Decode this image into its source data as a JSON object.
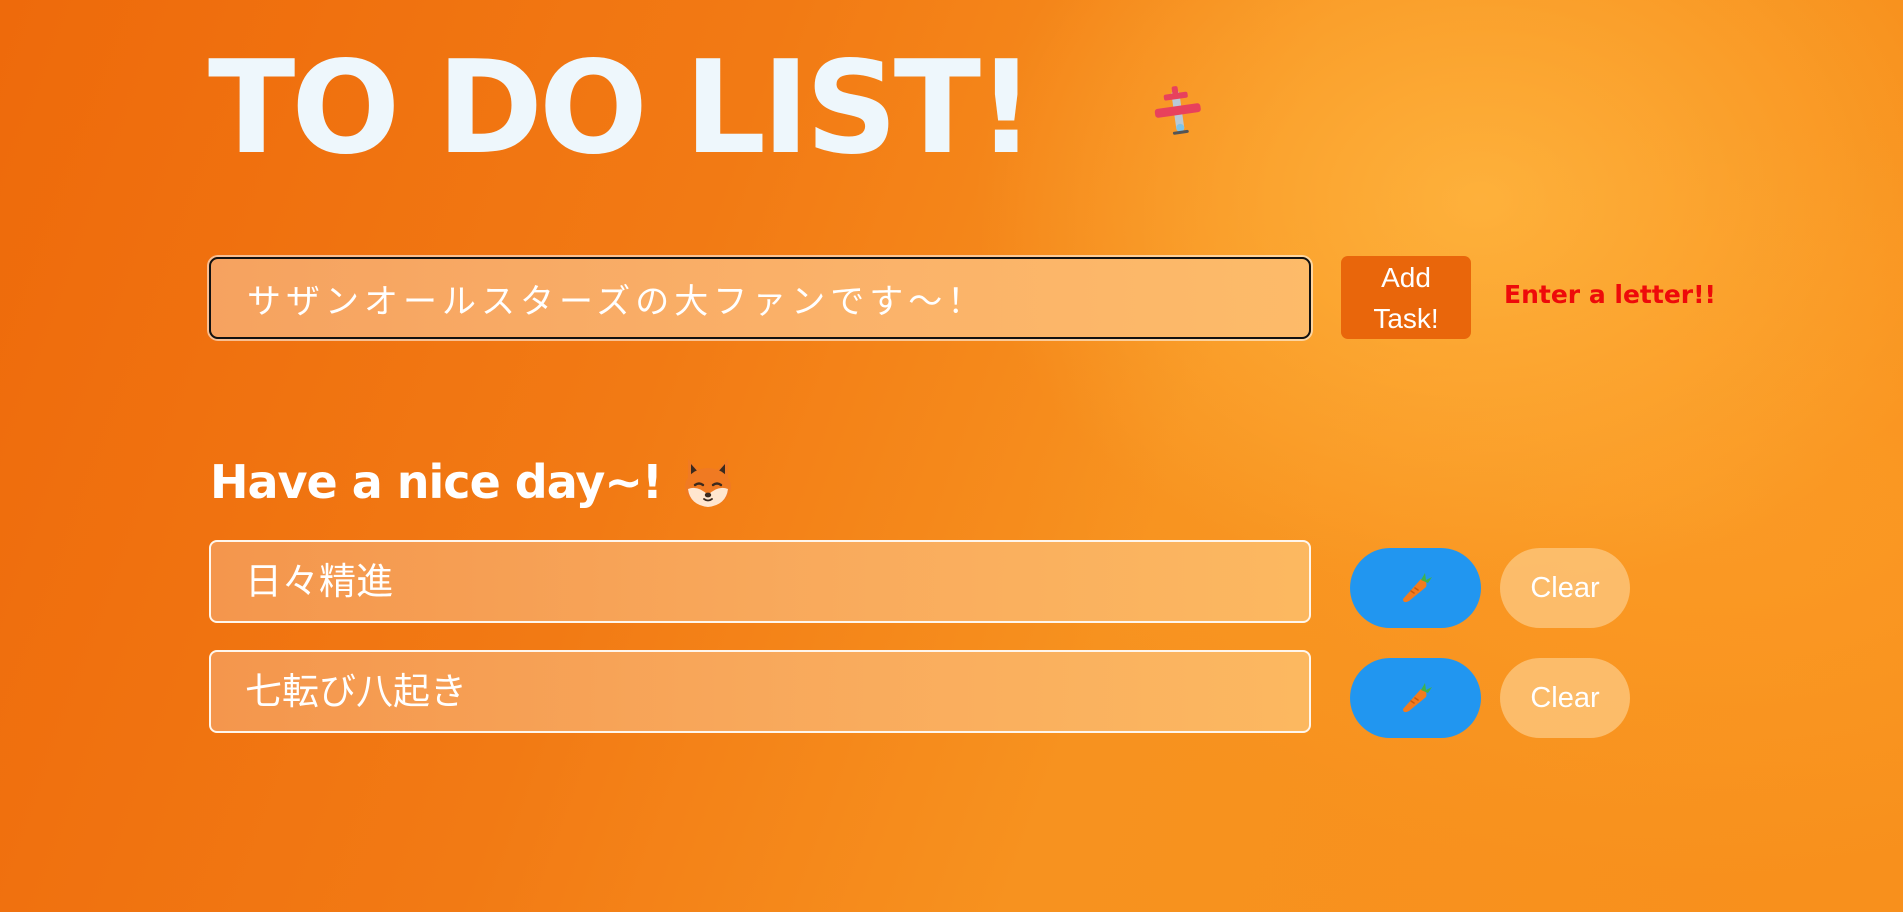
{
  "header": {
    "title": "TO DO LIST!",
    "decor_icon": "airplane-icon"
  },
  "input": {
    "value": "サザンオールスターズの大ファンです～！",
    "add_button_label": "Add Task!",
    "error_message": "Enter a letter!!"
  },
  "greeting": {
    "text": "Have a nice day~!",
    "icon": "fox-face-icon"
  },
  "tasks": [
    {
      "text": "日々精進",
      "action_icon": "carrot-icon",
      "clear_label": "Clear"
    },
    {
      "text": "七転び八起き",
      "action_icon": "carrot-icon",
      "clear_label": "Clear"
    }
  ],
  "colors": {
    "background_start": "#ee6a0b",
    "background_end": "#fbb03a",
    "title": "#eef7fc",
    "add_button": "#e9660b",
    "error": "#ee0a0a",
    "carrot_button": "#2196f0",
    "clear_button": "#fcc47a"
  }
}
